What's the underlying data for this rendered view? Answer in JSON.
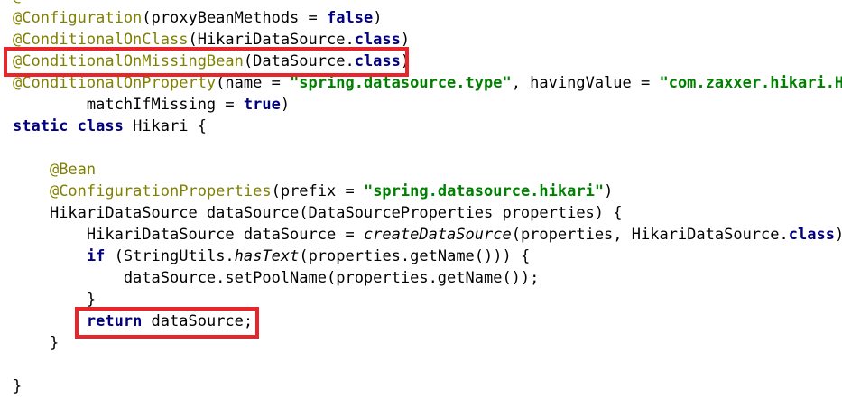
{
  "code": {
    "lines": [
      {
        "segments": [
          {
            "t": "@Configuration",
            "c": "ann"
          },
          {
            "t": "(proxyBeanMethods = "
          },
          {
            "t": "false",
            "c": "kw"
          },
          {
            "t": ")"
          }
        ]
      },
      {
        "segments": [
          {
            "t": "@ConditionalOnClass",
            "c": "ann"
          },
          {
            "t": "(HikariDataSource."
          },
          {
            "t": "class",
            "c": "kw"
          },
          {
            "t": ")"
          }
        ]
      },
      {
        "segments": [
          {
            "t": "@ConditionalOnMissingBean",
            "c": "ann"
          },
          {
            "t": "(DataSource."
          },
          {
            "t": "class",
            "c": "kw"
          },
          {
            "t": ")"
          }
        ]
      },
      {
        "segments": [
          {
            "t": "@ConditionalOnProperty",
            "c": "ann"
          },
          {
            "t": "(name = "
          },
          {
            "t": "\"spring.datasource.type\"",
            "c": "str"
          },
          {
            "t": ", havingValue = "
          },
          {
            "t": "\"com.zaxxer.hikari.Hik",
            "c": "str"
          }
        ]
      },
      {
        "segments": [
          {
            "t": "        matchIfMissing = "
          },
          {
            "t": "true",
            "c": "kw"
          },
          {
            "t": ")"
          }
        ]
      },
      {
        "segments": [
          {
            "t": "static class",
            "c": "kw"
          },
          {
            "t": " Hikari {"
          }
        ]
      },
      {
        "segments": []
      },
      {
        "segments": [
          {
            "t": "    "
          },
          {
            "t": "@Bean",
            "c": "ann"
          }
        ]
      },
      {
        "segments": [
          {
            "t": "    "
          },
          {
            "t": "@ConfigurationProperties",
            "c": "ann"
          },
          {
            "t": "(prefix = "
          },
          {
            "t": "\"spring.datasource.hikari\"",
            "c": "str"
          },
          {
            "t": ")"
          }
        ]
      },
      {
        "segments": [
          {
            "t": "    HikariDataSource dataSource(DataSourceProperties properties) {"
          }
        ]
      },
      {
        "segments": [
          {
            "t": "        HikariDataSource dataSource = "
          },
          {
            "t": "createDataSource",
            "c": "it"
          },
          {
            "t": "(properties, HikariDataSource."
          },
          {
            "t": "class",
            "c": "kw"
          },
          {
            "t": ");"
          }
        ]
      },
      {
        "segments": [
          {
            "t": "        "
          },
          {
            "t": "if",
            "c": "kw"
          },
          {
            "t": " (StringUtils."
          },
          {
            "t": "hasText",
            "c": "it"
          },
          {
            "t": "(properties.getName())) {"
          }
        ]
      },
      {
        "segments": [
          {
            "t": "            dataSource.setPoolName(properties.getName());"
          }
        ]
      },
      {
        "segments": [
          {
            "t": "        }"
          }
        ]
      },
      {
        "segments": [
          {
            "t": "        "
          },
          {
            "t": "return",
            "c": "kw"
          },
          {
            "t": " dataSource;"
          }
        ]
      },
      {
        "segments": [
          {
            "t": "    }"
          }
        ]
      },
      {
        "segments": []
      },
      {
        "segments": [
          {
            "t": "}"
          }
        ]
      }
    ],
    "top_fragment": "@"
  },
  "highlights": [
    {
      "label": "missing-bean-annotation"
    },
    {
      "label": "return-statement"
    }
  ],
  "colors": {
    "annotation": "#808000",
    "keyword": "#000080",
    "string": "#008000",
    "highlight_border": "#e8252b"
  }
}
